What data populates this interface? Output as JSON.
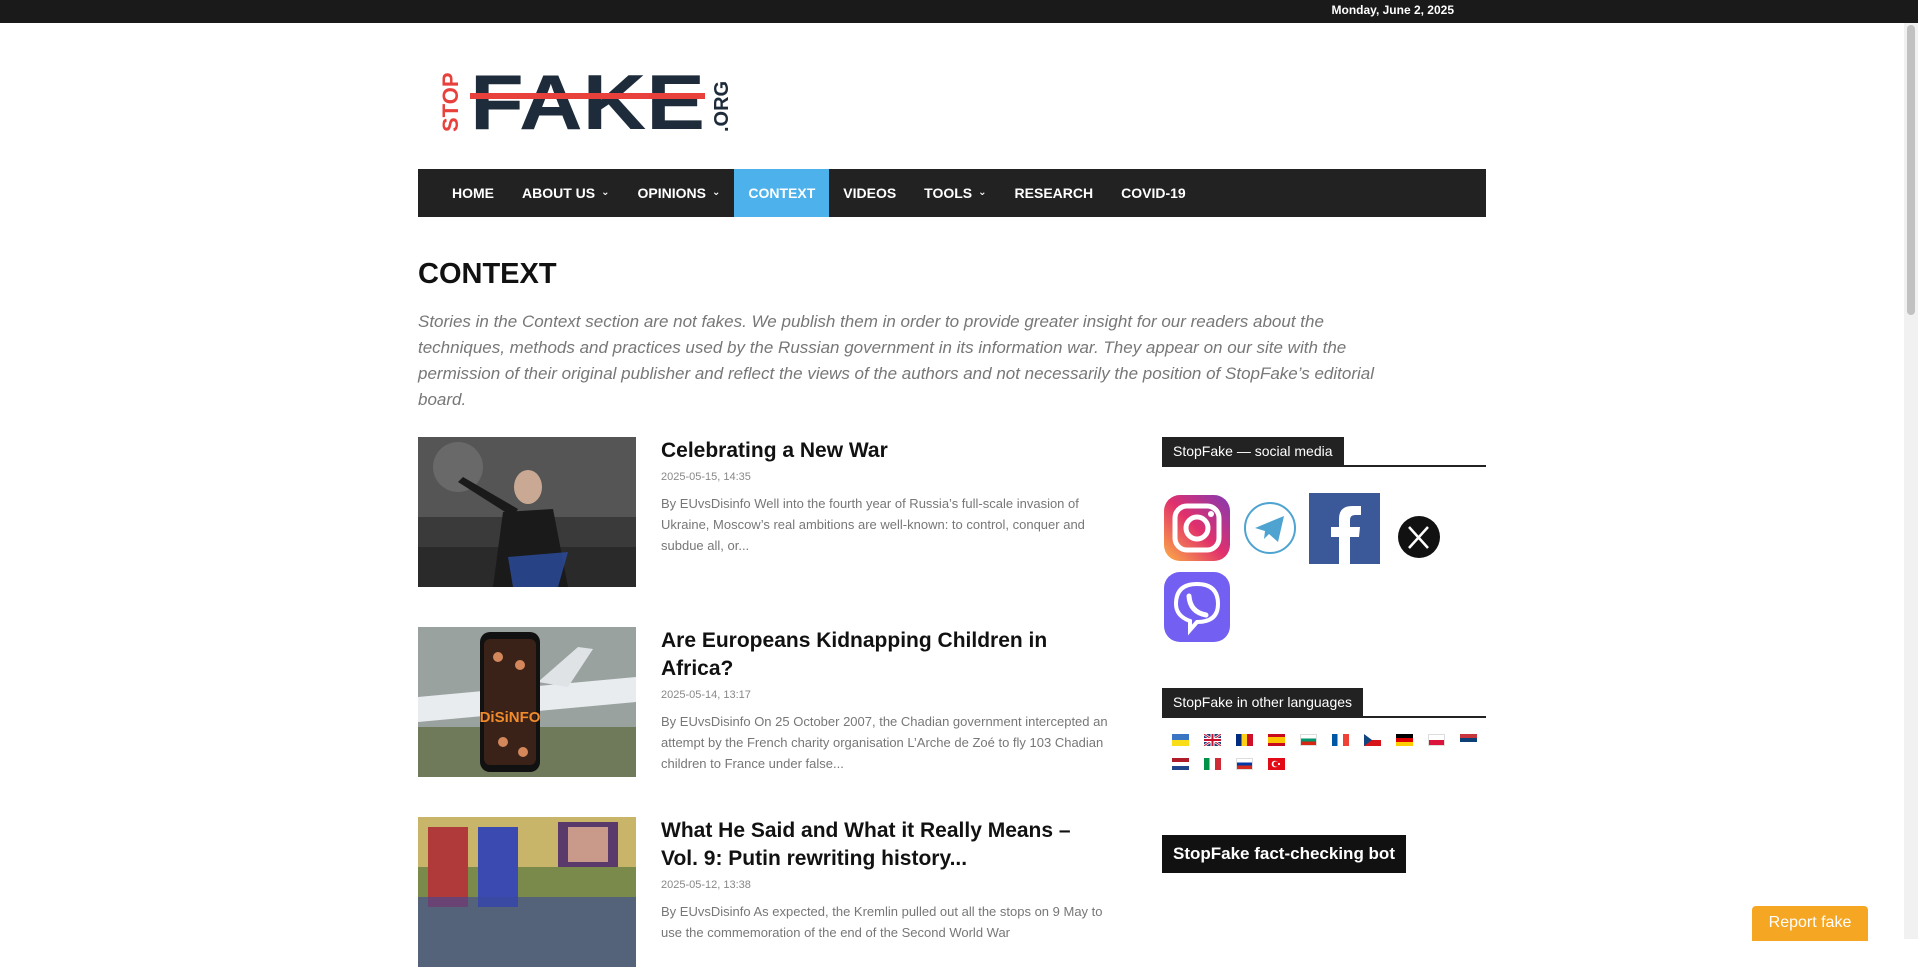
{
  "topbar": {
    "date": "Monday, June 2, 2025"
  },
  "logo": {
    "stop": "STOP",
    "fake": "FAKE",
    "org": ".ORG"
  },
  "nav": {
    "items": [
      {
        "label": "HOME",
        "dropdown": false
      },
      {
        "label": "ABOUT US",
        "dropdown": true
      },
      {
        "label": "OPINIONS",
        "dropdown": true
      },
      {
        "label": "CONTEXT",
        "dropdown": false,
        "active": true
      },
      {
        "label": "VIDEOS",
        "dropdown": false
      },
      {
        "label": "TOOLS",
        "dropdown": true
      },
      {
        "label": "RESEARCH",
        "dropdown": false
      },
      {
        "label": "COVID-19",
        "dropdown": false
      }
    ]
  },
  "page": {
    "title": "CONTEXT",
    "intro": "Stories in the Context section are not fakes. We publish them in order to provide greater insight for our readers about the techniques, methods and practices used by the Russian government in its information war. They appear on our site with the permission of their original publisher and reflect the views of the authors and not necessarily the position of StopFake’s editorial board."
  },
  "articles": [
    {
      "title": "Celebrating a New War",
      "date": "2025-05-15, 14:35",
      "excerpt": "By EUvsDisinfo Well into the fourth year of Russia’s full-scale invasion of Ukraine, Moscow’s real ambitions are well-known: to control, conquer and subdue all, or..."
    },
    {
      "title": "Are Europeans Kidnapping Children in Africa?",
      "date": "2025-05-14, 13:17",
      "excerpt": "By EUvsDisinfo On 25 October 2007, the Chadian government intercepted an attempt by the French charity organisation L’Arche de Zoé to fly 103 Chadian children to France under false...",
      "image_text": "DiSiNFO"
    },
    {
      "title": "What He Said and What it Really Means – Vol. 9: Putin rewriting history...",
      "date": "2025-05-12, 13:38",
      "excerpt": "By EUvsDisinfo As expected, the Kremlin pulled out all the stops on 9 May to use the commemoration of the end of the Second World War"
    }
  ],
  "sidebar": {
    "social_title": "StopFake — social media",
    "languages_title": "StopFake in other languages",
    "bot_title": "StopFake fact-checking bot",
    "social_icons": [
      "instagram-icon",
      "telegram-icon",
      "facebook-icon",
      "x-icon",
      "viber-icon"
    ],
    "flags": [
      "ukraine",
      "united-kingdom",
      "romania",
      "spain",
      "bulgaria",
      "france",
      "czech-republic",
      "germany",
      "poland",
      "serbia",
      "netherlands",
      "italy",
      "russia",
      "turkey"
    ]
  },
  "report_button": "Report fake",
  "colors": {
    "accent": "#4db2ec",
    "logo_red": "#e8413c",
    "logo_dark": "#1d2b3a",
    "report": "#f5a623"
  }
}
